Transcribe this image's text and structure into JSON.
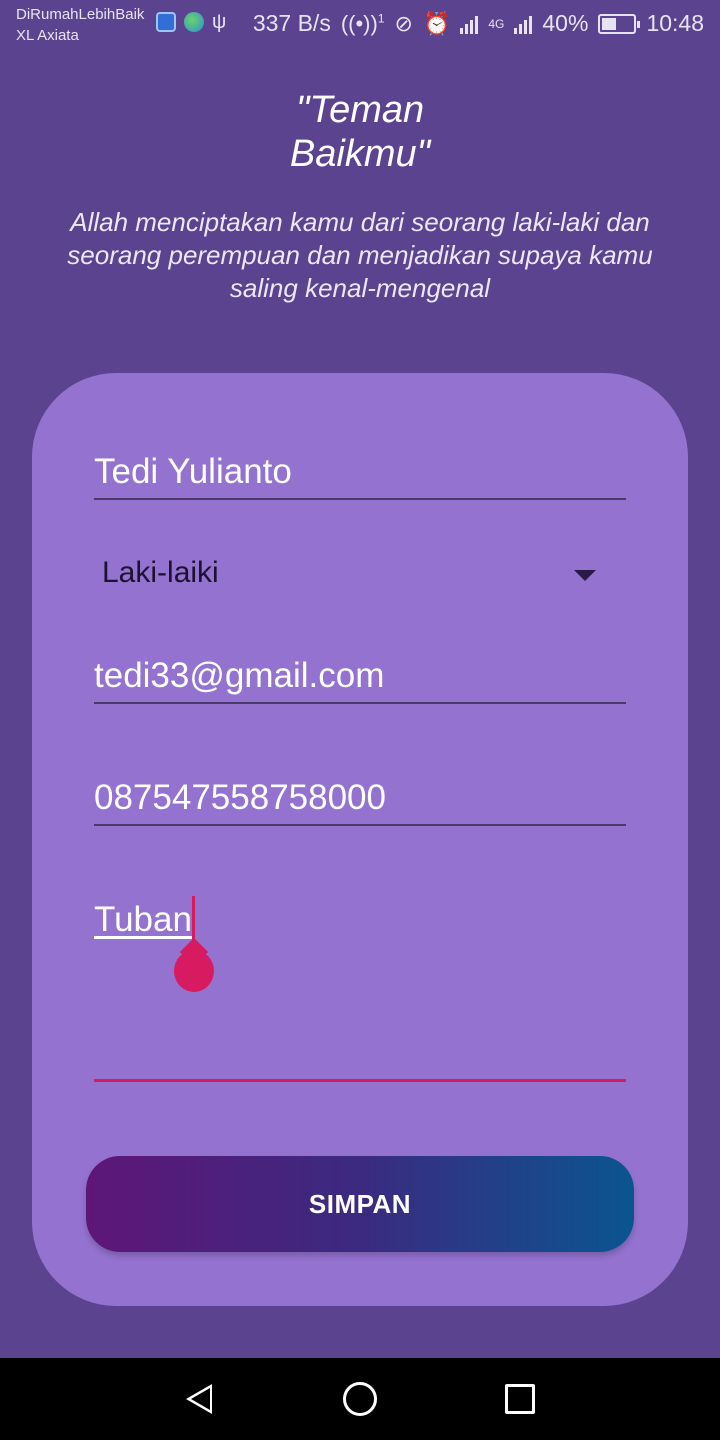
{
  "status_bar": {
    "carrier_line1": "DiRumahLebihBaik",
    "carrier_line2": "XL Axiata",
    "network_speed": "337 B/s",
    "hotspot_badge": "1",
    "network_type": "4G",
    "battery_percent": "40%",
    "time": "10:48"
  },
  "header": {
    "title_line1": "\"Teman",
    "title_line2": "Baikmu\"",
    "subtitle": "Allah menciptakan kamu dari seorang laki-laki dan seorang perempuan dan menjadikan supaya kamu saling kenal-mengenal"
  },
  "form": {
    "name": "Tedi Yulianto",
    "gender": "Laki-laiki",
    "email": "tedi33@gmail.com",
    "phone": "087547558758000",
    "address": "Tuban",
    "save_label": "SIMPAN"
  },
  "colors": {
    "background": "#5c438f",
    "card": "#9472d0",
    "accent": "#d81b60",
    "button_gradient_start": "#5e1677",
    "button_gradient_end": "#0a5590"
  }
}
